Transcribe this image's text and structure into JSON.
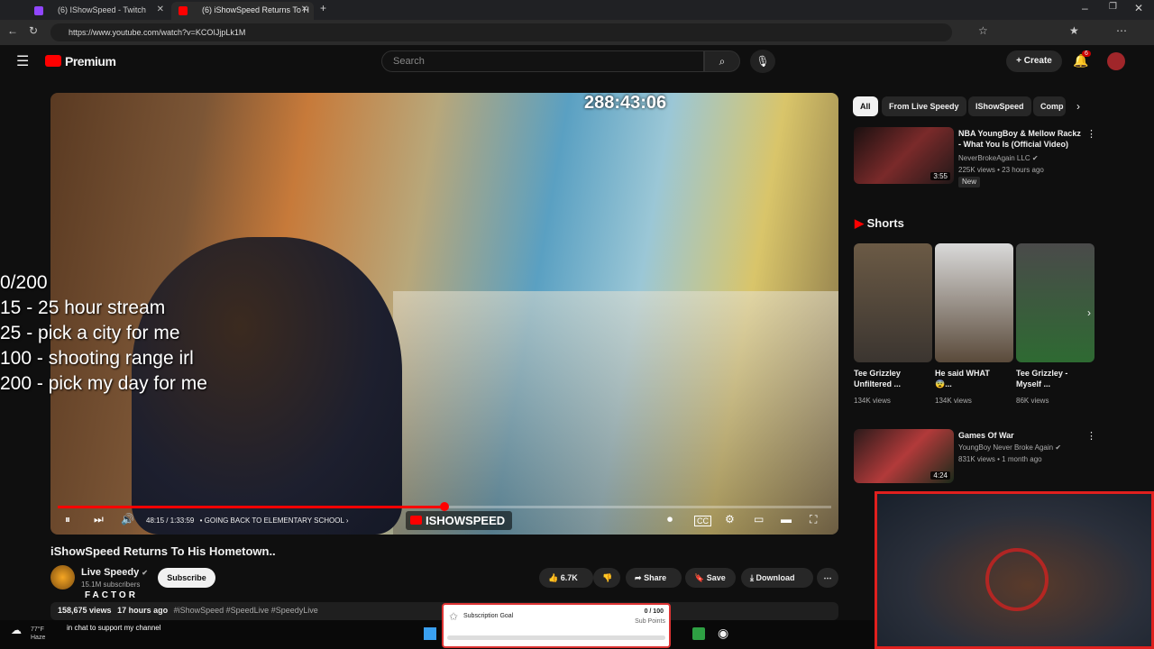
{
  "browser": {
    "tabs": [
      {
        "label": "(6) IShowSpeed - Twitch",
        "favicon_color": "#9146ff"
      },
      {
        "label": "(6) iShowSpeed Returns To H",
        "favicon_color": "#ff0000"
      }
    ],
    "url": "https://www.youtube.com/watch?v=KCOIJjpLk1M"
  },
  "youtube": {
    "logo_text": "Premium",
    "search_placeholder": "Search",
    "create_label": "Create",
    "notification_count": "6"
  },
  "video": {
    "stream_timer": "288:43:06",
    "current_time": "48:15 / 1:33:59",
    "chapter": "• GOING BACK TO ELEMENTARY SCHOOL",
    "watermark": "ISHOWSPEED",
    "progress_fraction": 0.5
  },
  "overlay": {
    "goals": [
      "0/200",
      "15 - 25 hour stream",
      "25 - pick a city for me",
      "100 - shooting range irl",
      "200 - pick my day for me"
    ],
    "factor_text": "FACTOR",
    "chat_message": "in chat to support my channel",
    "weather_temp": "77°F",
    "weather_cond": "Haze",
    "sub_goal_title": "Subscription Goal",
    "sub_goal_count": "0 / 100",
    "sub_goal_unit": "Sub Points"
  },
  "details": {
    "title": "iShowSpeed Returns To His Hometown..",
    "channel": "Live Speedy",
    "subscribers": "15.1M subscribers",
    "subscribe_label": "Subscribe",
    "likes": "6.7K",
    "share_label": "Share",
    "save_label": "Save",
    "download_label": "Download",
    "meta_views": "158,675 views",
    "meta_ago": "17 hours ago",
    "meta_tags": "#iShowSpeed #SpeedLive #SpeedyLive"
  },
  "sidebar": {
    "chips": [
      "All",
      "From Live Speedy",
      "IShowSpeed",
      "Comp"
    ],
    "top_video": {
      "title": "NBA YoungBoy & Mellow Rackz - What You Is (Official Video)",
      "channel": "NeverBrokeAgain LLC",
      "stats": "225K views • 23 hours ago",
      "badge": "New",
      "duration": "3:55"
    },
    "shorts_heading": "Shorts",
    "shorts": [
      {
        "title": "Tee Grizzley Unfiltered ...",
        "views": "134K views"
      },
      {
        "title": "He said WHAT 😨...",
        "views": "134K views"
      },
      {
        "title": "Tee Grizzley - Myself ...",
        "views": "86K views"
      }
    ],
    "bottom_video": {
      "title": "Games Of War",
      "channel": "YoungBoy Never Broke Again",
      "stats": "831K views • 1 month ago",
      "duration": "4:24"
    }
  }
}
